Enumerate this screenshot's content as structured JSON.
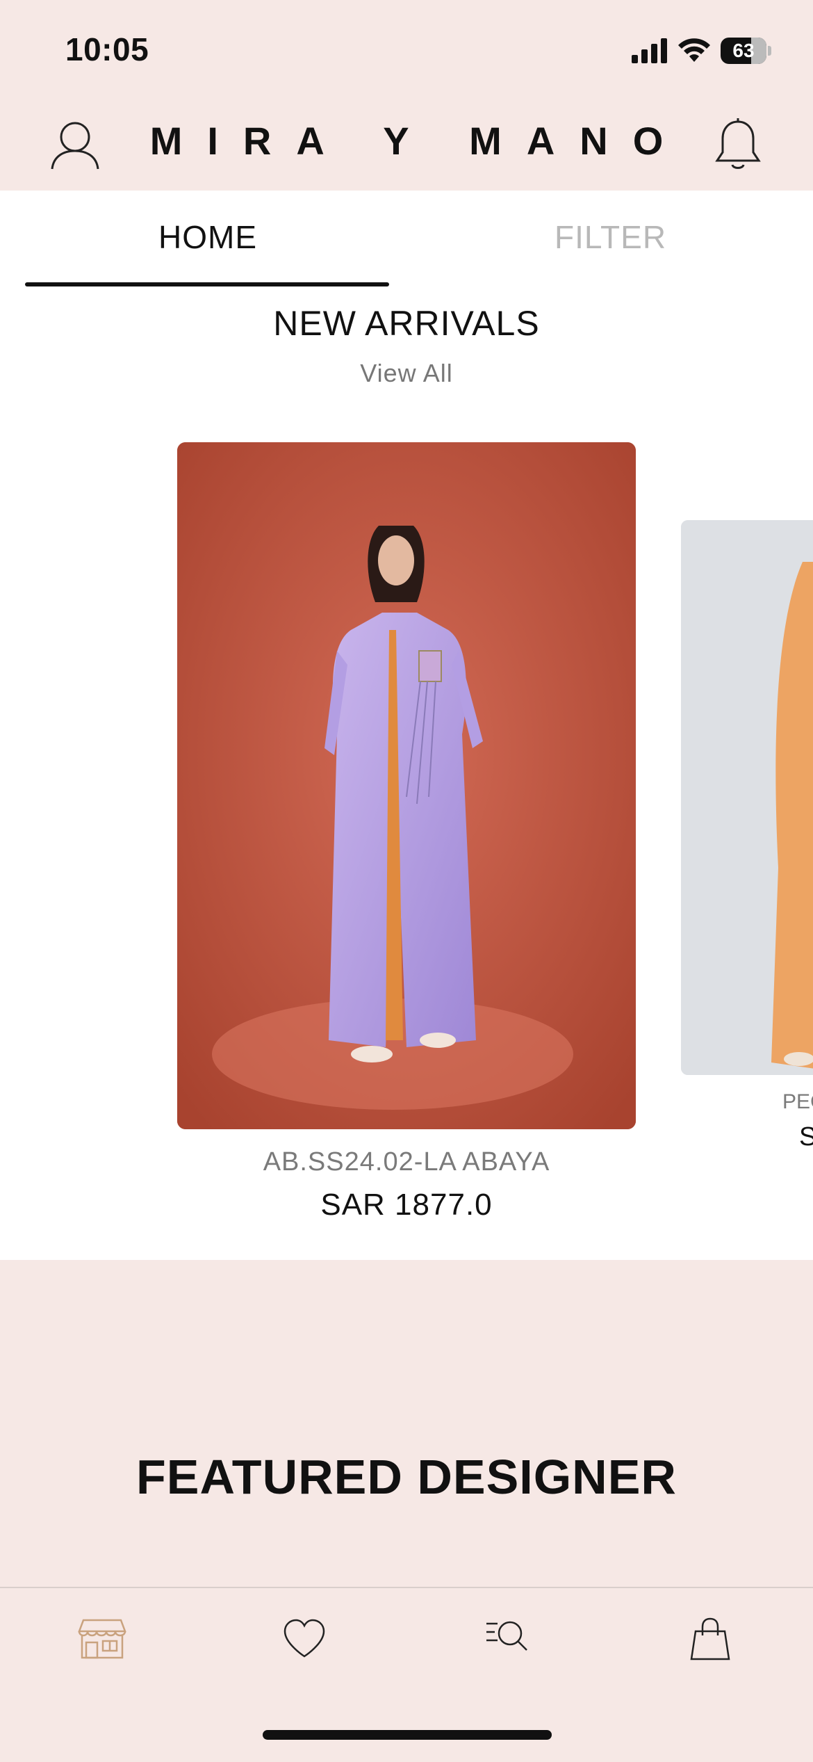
{
  "status_bar": {
    "time": "10:05",
    "battery_level": "63"
  },
  "header": {
    "brand": "MIRA Y MANO"
  },
  "tabs": [
    {
      "label": "HOME",
      "active": true
    },
    {
      "label": "FILTER",
      "active": false
    }
  ],
  "new_arrivals": {
    "title": "NEW ARRIVALS",
    "view_all": "View All",
    "products": [
      {
        "name": "AB.SS24.02-LA ABAYA",
        "price": "SAR 1877.0"
      },
      {
        "name": "PEC",
        "price": "S"
      }
    ]
  },
  "featured": {
    "title": "FEATURED DESIGNER"
  },
  "bottom_nav": {
    "items": [
      {
        "icon": "store-icon",
        "active": true
      },
      {
        "icon": "heart-icon",
        "active": false
      },
      {
        "icon": "search-list-icon",
        "active": false
      },
      {
        "icon": "shopping-bag-icon",
        "active": false
      }
    ]
  },
  "colors": {
    "header_bg": "#f6e8e5",
    "accent_active_nav": "#c9a27e",
    "inactive_tab": "#b8b8b8"
  }
}
